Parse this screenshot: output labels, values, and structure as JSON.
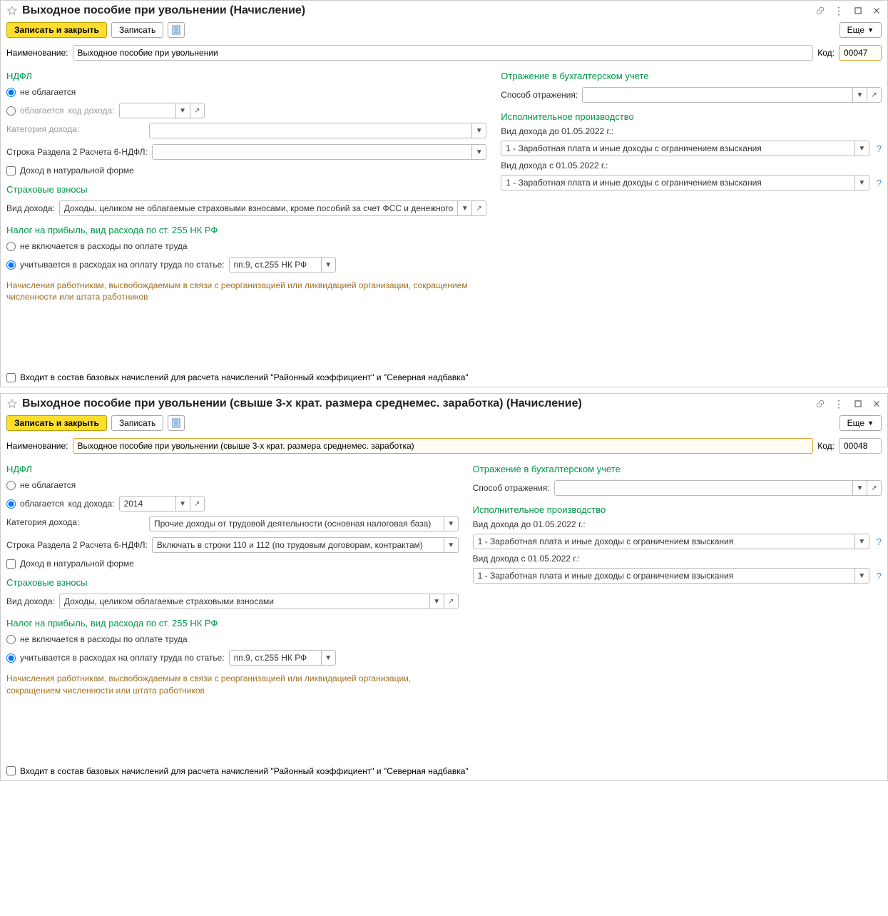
{
  "common": {
    "save_close": "Записать и закрыть",
    "save": "Записать",
    "more": "Еще",
    "name_label": "Наименование:",
    "code_label": "Код:",
    "ndfl_title": "НДФЛ",
    "ndfl_not_taxed": "не облагается",
    "ndfl_taxed": "облагается",
    "income_code_label": "код дохода:",
    "income_category_label": "Категория дохода:",
    "row_section2_label": "Строка Раздела 2 Расчета 6-НДФЛ:",
    "natural_income": "Доход в натуральной форме",
    "insurance_title": "Страховые взносы",
    "income_type_label": "Вид дохода:",
    "profit_tax_title": "Налог на прибыль, вид расхода по ст. 255 НК РФ",
    "profit_not_included": "не включается в расходы по оплате труда",
    "profit_accounted": "учитывается в расходах на оплату труда по статье:",
    "profit_article": "пп.9, ст.255 НК РФ",
    "help_text": "Начисления работникам, высвобождаемым в связи с реорганизацией или ликвидацией организации, сокращением численности или штата работников",
    "accounting_title": "Отражение в бухгалтерском учете",
    "accounting_method": "Способ отражения:",
    "execution_title": "Исполнительное производство",
    "income_before": "Вид дохода до 01.05.2022 г.:",
    "income_after": "Вид дохода с 01.05.2022 г.:",
    "exec_value": "1 - Заработная плата и иные доходы с ограничением взыскания",
    "footer_check": "Входит в состав базовых начислений для расчета начислений \"Районный коэффициент\" и \"Северная надбавка\""
  },
  "win1": {
    "title": "Выходное пособие  при увольнении (Начисление)",
    "name": "Выходное пособие  при увольнении",
    "code": "00047",
    "insurance_value": "Доходы, целиком не облагаемые страховыми взносами, кроме пособий за счет ФСС и денежного"
  },
  "win2": {
    "title": "Выходное пособие при увольнении (свыше 3-х крат. размера среднемес. заработка) (Начисление)",
    "name": "Выходное пособие при увольнении (свыше 3-х крат. размера среднемес. заработка)",
    "code": "00048",
    "income_code": "2014",
    "income_category": "Прочие доходы от трудовой деятельности (основная налоговая база)",
    "row_section2": "Включать в строки 110 и 112 (по трудовым договорам, контрактам)",
    "insurance_value": "Доходы, целиком облагаемые страховыми взносами"
  }
}
